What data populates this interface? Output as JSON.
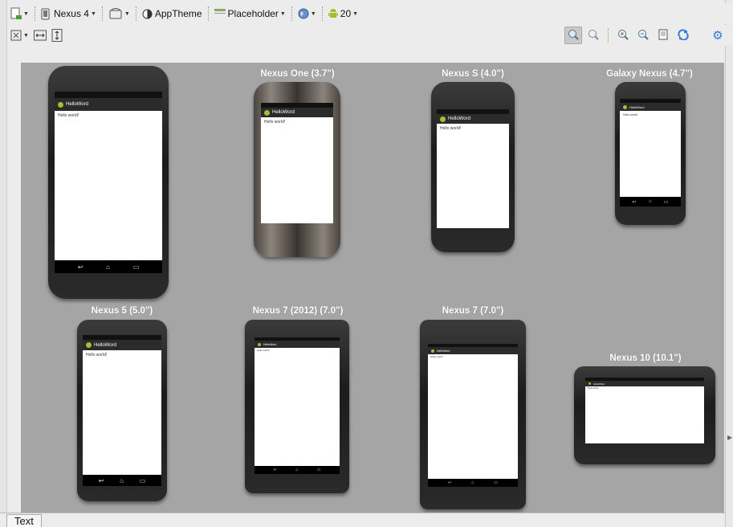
{
  "toolbar": {
    "device": "Nexus 4",
    "theme": "AppTheme",
    "activity": "Placeholder",
    "api": "20"
  },
  "app": {
    "title": "HelloWord",
    "content": "Hello world!"
  },
  "devices": [
    {
      "label": ""
    },
    {
      "label": "Nexus One (3.7\")"
    },
    {
      "label": "Nexus S (4.0\")"
    },
    {
      "label": "Galaxy Nexus (4.7\")"
    },
    {
      "label": "Nexus 5 (5.0\")"
    },
    {
      "label": "Nexus 7 (2012) (7.0\")"
    },
    {
      "label": "Nexus 7 (7.0\")"
    },
    {
      "label": "Nexus 10 (10.1\")"
    }
  ],
  "bottom": {
    "tab": "Text"
  },
  "colors": {
    "canvas": "#a5a5a5",
    "bezel": "#1e1e1e",
    "actionbar": "#2b2b2b",
    "android_green": "#9fc031",
    "toolbar_bg": "#ececec"
  }
}
